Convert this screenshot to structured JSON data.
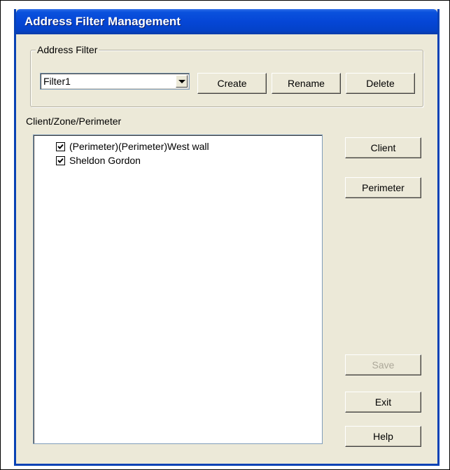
{
  "window": {
    "title": "Address Filter Management"
  },
  "address_filter": {
    "group_label": "Address Filter",
    "selected_filter": "Filter1",
    "create_label": "Create",
    "rename_label": "Rename",
    "delete_label": "Delete"
  },
  "list_section": {
    "label": "Client/Zone/Perimeter",
    "items": [
      {
        "label": "(Perimeter)(Perimeter)West wall",
        "checked": true
      },
      {
        "label": "Sheldon Gordon",
        "checked": true
      }
    ]
  },
  "side_buttons": {
    "client_label": "Client",
    "perimeter_label": "Perimeter",
    "save_label": "Save",
    "save_enabled": false,
    "exit_label": "Exit",
    "help_label": "Help"
  }
}
